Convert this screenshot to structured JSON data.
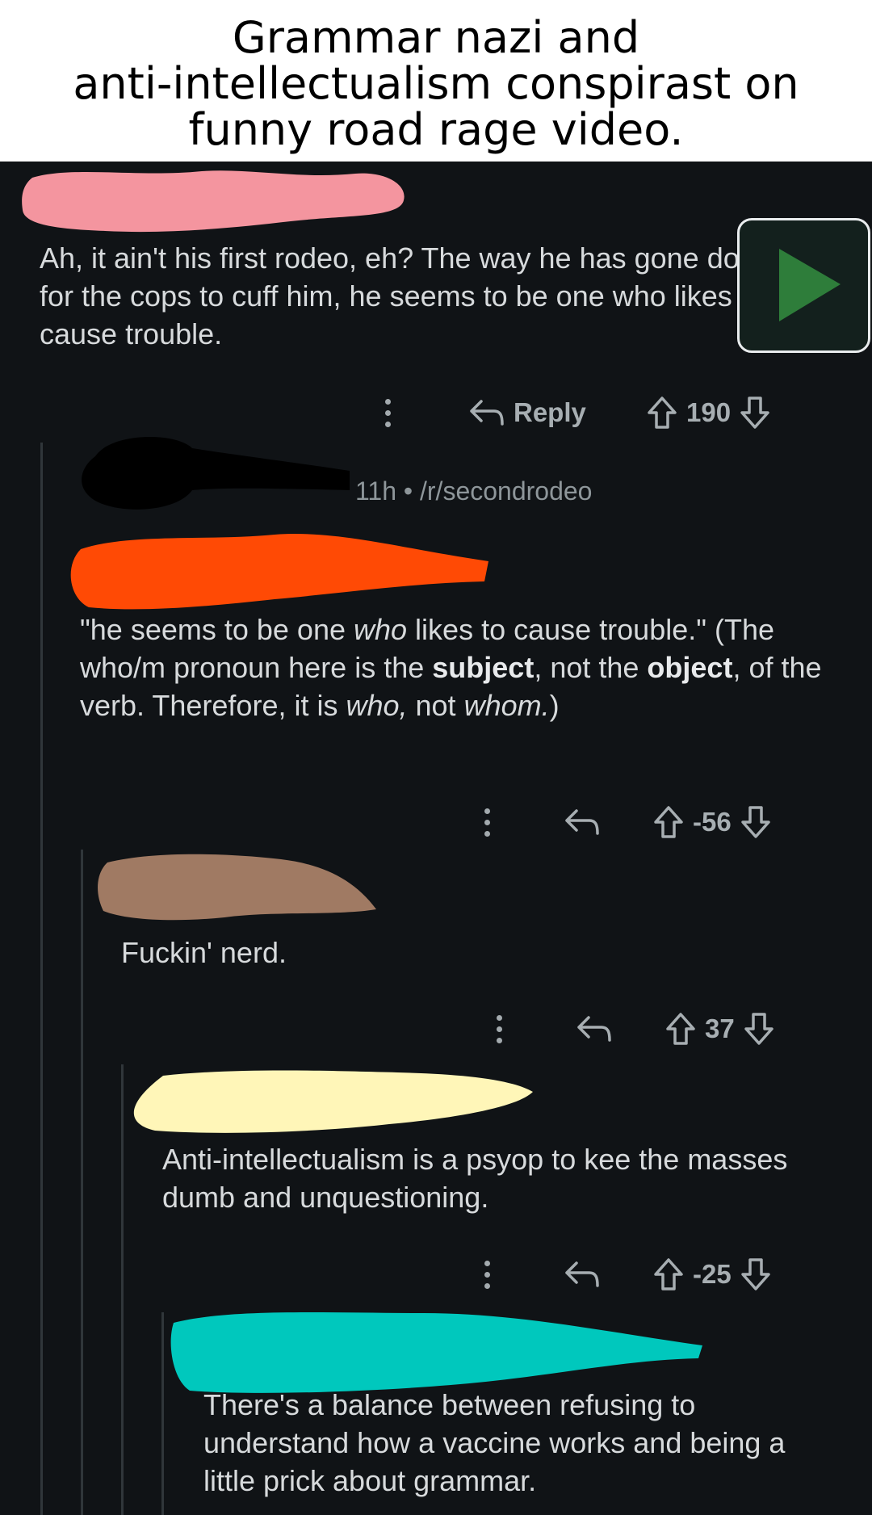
{
  "caption": {
    "lines": [
      "Grammar nazi and",
      "anti-intellectualism conspirast on",
      "funny road rage video."
    ]
  },
  "comments": [
    {
      "text": "Ah, it ain't his first rodeo, eh? The way he has gone down for the cops to cuff him, he seems to be one who likes to cause trouble.",
      "reply_label": "Reply",
      "votes": "190",
      "scribble_color": "#f4959f"
    },
    {
      "meta": "11h • /r/secondrodeo",
      "text_parts": {
        "p1": "\"he seems to be one ",
        "p2": "who",
        "p3": " likes to cause trouble.\" (The who/m pronoun here is the ",
        "p4": "subject",
        "p5": ", not the ",
        "p6": "object",
        "p7": ", of the verb. Therefore, it is ",
        "p8": "who,",
        "p9": " not ",
        "p10": "whom.",
        "p11": ")"
      },
      "votes": "-56",
      "scribble_color": "#ff4a05"
    },
    {
      "text": "Fuckin' nerd.",
      "votes": "37",
      "scribble_color": "#a07a63"
    },
    {
      "text": "Anti-intellectualism is a psyop to kee the masses dumb and unquestioning.",
      "votes": "-25",
      "scribble_color": "#fff6b8"
    },
    {
      "text": "There's a balance between refusing to understand how a vaccine works and being a little prick about grammar.",
      "scribble_color": "#00c8bd"
    }
  ],
  "icons": {
    "play": "play-icon",
    "reply": "reply-arrow-icon",
    "upvote": "upvote-arrow-icon",
    "downvote": "downvote-arrow-icon",
    "more": "more-vertical-icon"
  },
  "colors": {
    "background": "#101316",
    "text": "#d7dadc",
    "muted": "#8d9498",
    "play_fill": "#2e7d3a"
  }
}
